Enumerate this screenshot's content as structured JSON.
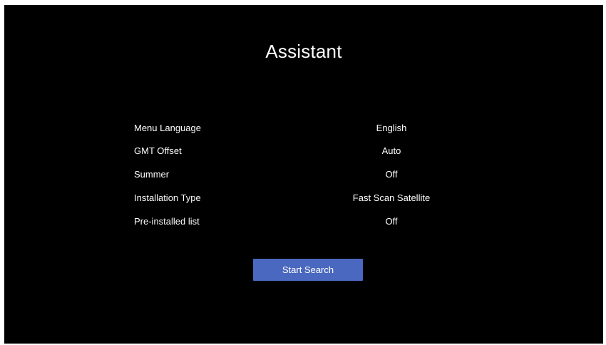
{
  "screen": {
    "title": "Assistant"
  },
  "settings": [
    {
      "label": "Menu Language",
      "value": "English"
    },
    {
      "label": "GMT Offset",
      "value": "Auto"
    },
    {
      "label": "Summer",
      "value": "Off"
    },
    {
      "label": "Installation Type",
      "value": "Fast Scan Satellite"
    },
    {
      "label": "Pre-installed list",
      "value": "Off"
    }
  ],
  "actions": {
    "start_search_label": "Start Search"
  },
  "colors": {
    "background": "#000000",
    "text": "#ffffff",
    "button": "#4a68bf"
  }
}
